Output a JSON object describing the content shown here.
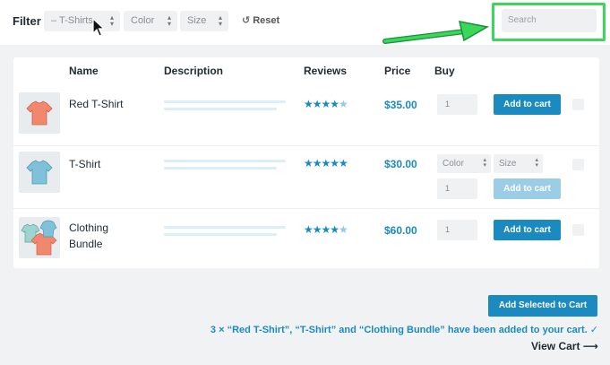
{
  "filter": {
    "label": "Filter",
    "category_value": "– T-Shirts",
    "color_placeholder": "Color",
    "size_placeholder": "Size",
    "reset_label": "Reset"
  },
  "search": {
    "placeholder": "Search"
  },
  "table": {
    "headers": {
      "name": "Name",
      "description": "Description",
      "reviews": "Reviews",
      "price": "Price",
      "buy": "Buy"
    },
    "rows": [
      {
        "name_line1": "Red T-Shirt",
        "name_line2": "",
        "rating": 4.5,
        "price": "$35.00",
        "qty": "1",
        "button": "Add to cart"
      },
      {
        "name_line1": "T-Shirt",
        "name_line2": "",
        "rating": 5,
        "price": "$30.00",
        "qty": "1",
        "color": "Color",
        "size": "Size",
        "button": "Add to cart"
      },
      {
        "name_line1": "Clothing",
        "name_line2": "Bundle",
        "rating": 4.5,
        "price": "$60.00",
        "qty": "1",
        "button": "Add to cart"
      }
    ]
  },
  "footer": {
    "add_selected": "Add Selected to Cart",
    "notice": "3 × “Red T-Shirt”, “T-Shirt” and “Clothing Bundle” have been added to your cart.",
    "notice_check": "✓",
    "view_cart": "View Cart",
    "view_cart_arrow": "⟶"
  },
  "icons": {
    "caret": "▴▾",
    "reset": "↺",
    "star_full": "★",
    "star_half": "★"
  },
  "colors": {
    "accent": "#1a8ac1",
    "highlight": "#3cd65a"
  }
}
